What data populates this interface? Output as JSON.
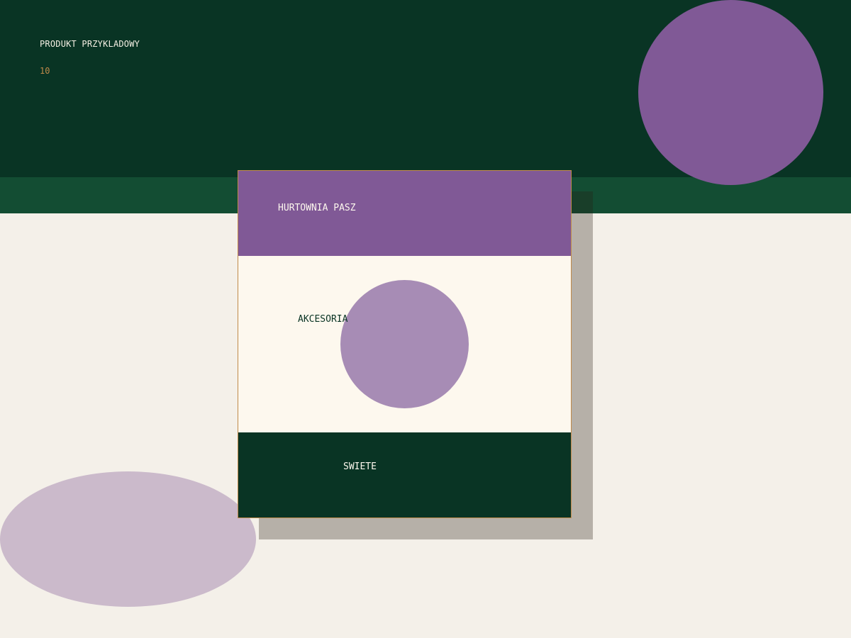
{
  "header": {
    "title": "PRODUKT PRZYKLADOWY",
    "count": "10"
  },
  "card": {
    "top_label": "HURTOWNIA PASZ",
    "middle_label": "AKCESORIA",
    "bottom_label": "SWIETE"
  },
  "colors": {
    "dark_green": "#093424",
    "mid_green": "#134d33",
    "purple": "#805996",
    "light_purple": "#a78cb5",
    "pale_purple": "#cbbacb",
    "cream": "#fdf8ee",
    "background": "#f4f0e9",
    "accent_gold": "#c08a4a"
  }
}
